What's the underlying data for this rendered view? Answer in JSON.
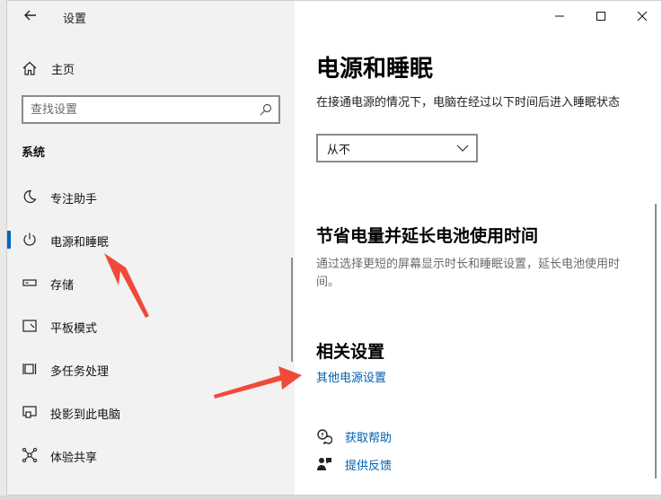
{
  "window": {
    "title": "设置",
    "controls": [
      "minimize-icon",
      "maximize-icon",
      "close-icon"
    ]
  },
  "sidebar": {
    "home_label": "主页",
    "search_placeholder": "查找设置",
    "section_label": "系统",
    "items": [
      {
        "label": "专注助手",
        "icon": "moon-icon"
      },
      {
        "label": "电源和睡眠",
        "icon": "power-icon",
        "active": true
      },
      {
        "label": "存储",
        "icon": "storage-icon"
      },
      {
        "label": "平板模式",
        "icon": "tablet-icon"
      },
      {
        "label": "多任务处理",
        "icon": "multitask-icon"
      },
      {
        "label": "投影到此电脑",
        "icon": "project-icon"
      },
      {
        "label": "体验共享",
        "icon": "share-icon"
      }
    ]
  },
  "main": {
    "title": "电源和睡眠",
    "sleep_desc": "在接通电源的情况下，电脑在经过以下时间后进入睡眠状态",
    "sleep_value": "从不",
    "battery_heading": "节省电量并延长电池使用时间",
    "battery_desc": "通过选择更短的屏幕显示时长和睡眠设置，延长电池使用时间。",
    "related_heading": "相关设置",
    "related_link": "其他电源设置",
    "help_items": [
      {
        "label": "获取帮助",
        "icon": "help-chat-icon"
      },
      {
        "label": "提供反馈",
        "icon": "feedback-icon"
      }
    ]
  },
  "colors": {
    "accent": "#0067c0",
    "link": "#0060b0",
    "annotation_arrow": "#f04a3a",
    "sidebar_bg": "#f2f2f2"
  }
}
